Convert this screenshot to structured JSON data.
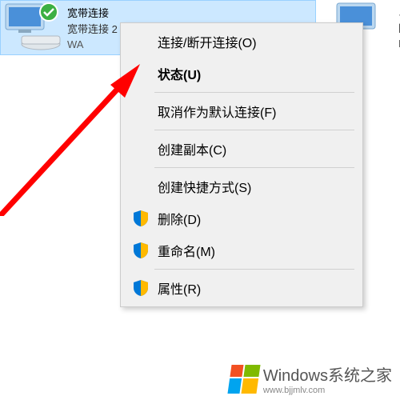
{
  "adapters": {
    "broadband": {
      "title": "宽带连接",
      "line1": "宽带连接 2",
      "line2": "WA",
      "selected": true
    },
    "ethernet": {
      "title": "以",
      "line1": "网",
      "line2": "R"
    }
  },
  "context_menu": {
    "items": [
      {
        "label": "连接/断开连接(O)",
        "bold": false,
        "shield": false
      },
      {
        "label": "状态(U)",
        "bold": true,
        "shield": false
      }
    ],
    "group2": [
      {
        "label": "取消作为默认连接(F)",
        "shield": false
      }
    ],
    "group3": [
      {
        "label": "创建副本(C)",
        "shield": false
      }
    ],
    "group4": [
      {
        "label": "创建快捷方式(S)",
        "shield": false
      },
      {
        "label": "删除(D)",
        "shield": true
      },
      {
        "label": "重命名(M)",
        "shield": true
      }
    ],
    "group5": [
      {
        "label": "属性(R)",
        "shield": true
      }
    ]
  },
  "watermark": {
    "text": "Windows系统之家",
    "url": "www.bjjmlv.com"
  },
  "icons": {
    "monitor": "display-icon",
    "modem": "modem-icon",
    "check": "checkmark-icon",
    "shield": "uac-shield-icon"
  }
}
